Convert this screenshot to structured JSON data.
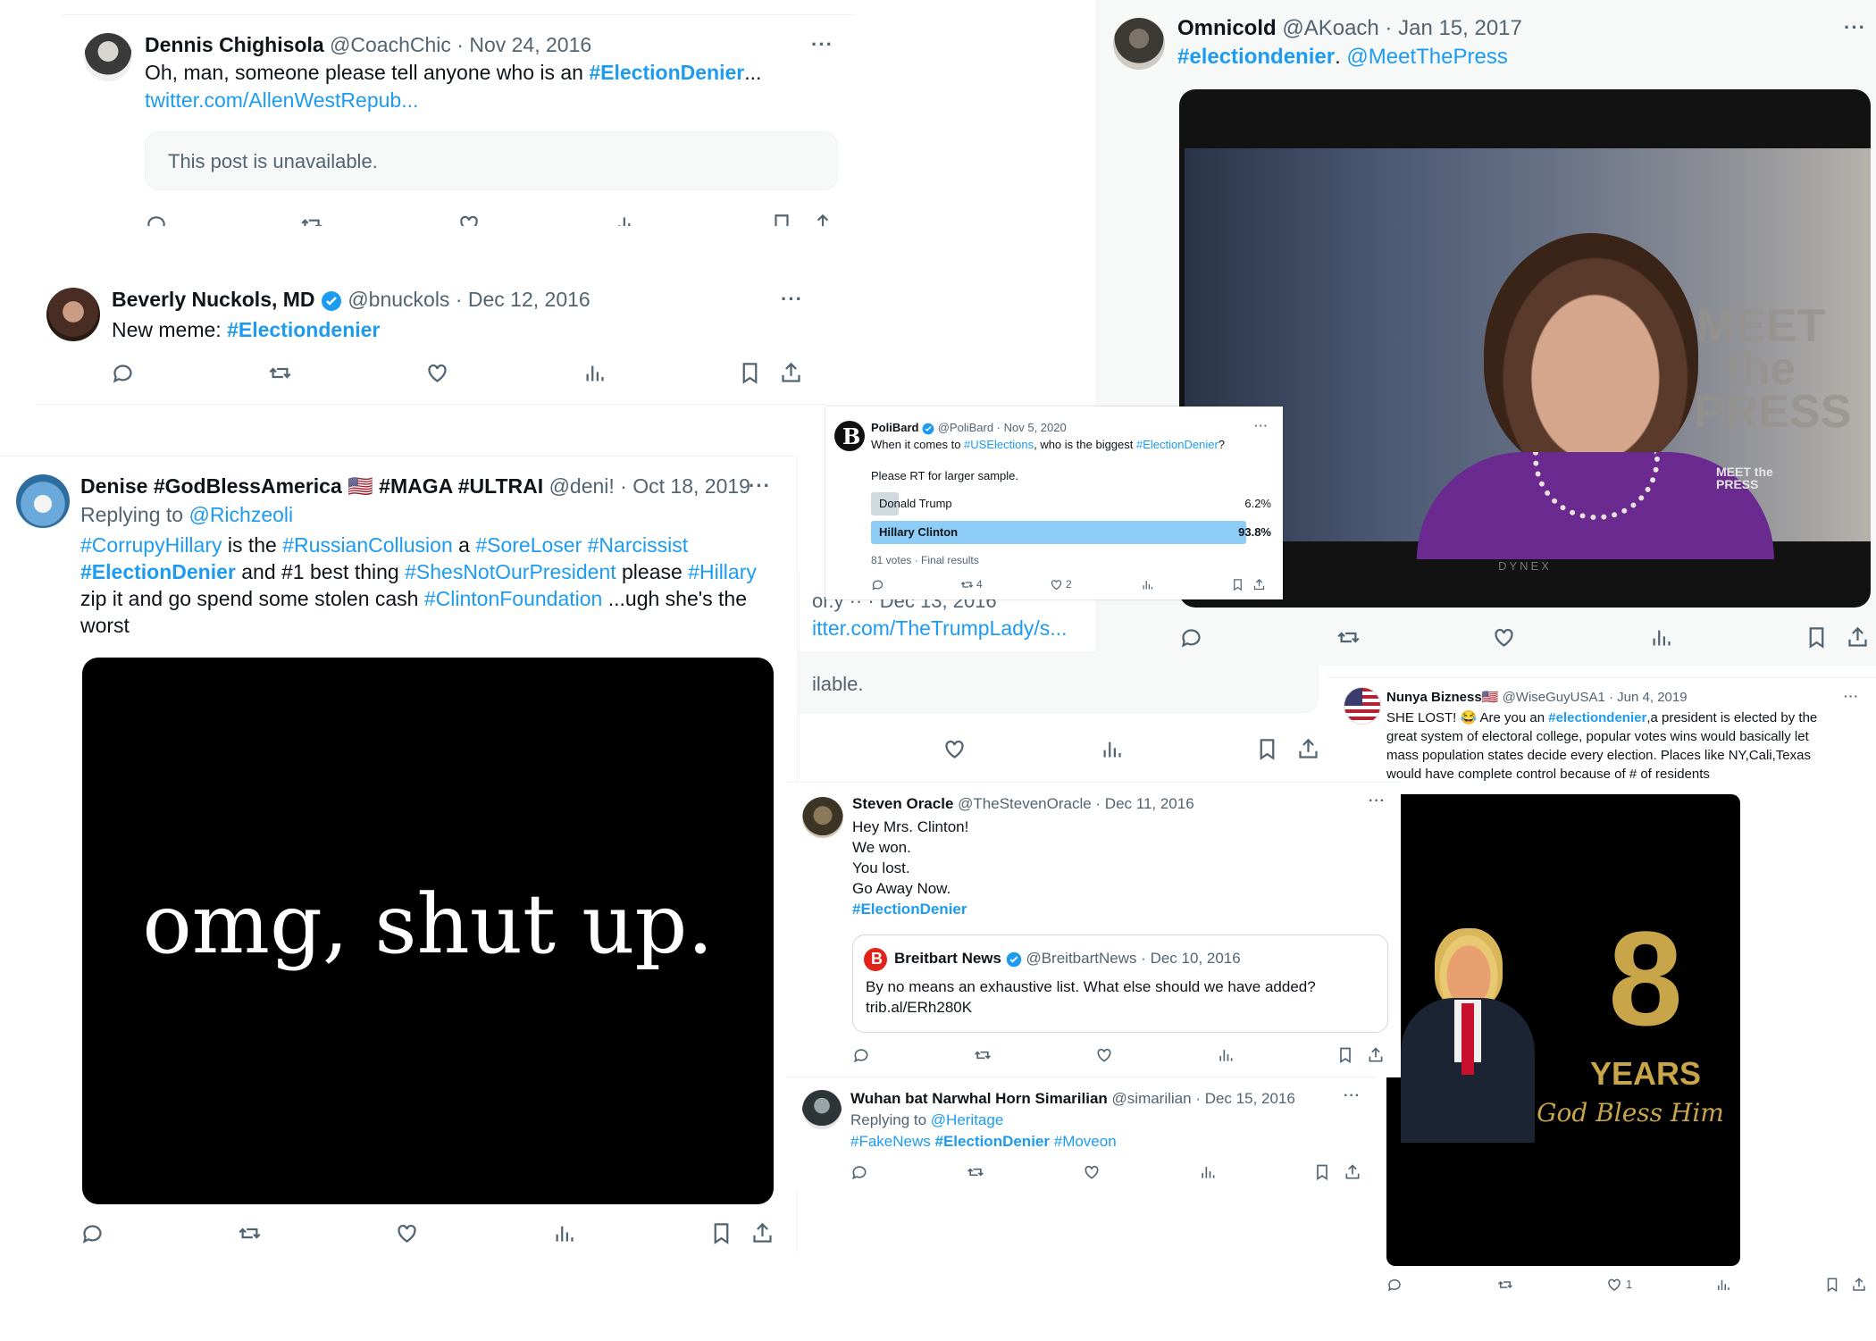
{
  "dennis": {
    "name": "Dennis Chighisola",
    "handle": "@CoachChic",
    "date": "Nov 24, 2016",
    "text": "Oh, man, someone please tell anyone who is an ",
    "tag": "#ElectionDenier",
    "ellipsis": "...",
    "link": "twitter.com/AllenWestRepub...",
    "unavailable": "This post is unavailable."
  },
  "beverly": {
    "name": "Beverly Nuckols, MD",
    "handle": "@bnuckols",
    "date": "Dec 12, 2016",
    "text": "New meme: ",
    "tag": "#Electiondenier"
  },
  "denise": {
    "name": "Denise #GodBlessAmerica 🇺🇸 #MAGA #ULTRAI",
    "handle": "@deni!",
    "date": "Oct 18, 2019",
    "replying_prefix": "Replying to ",
    "replying_to": "@Richzeoli",
    "line1": {
      "t1": "#CorrupyHillary",
      "t2": " is the ",
      "t3": "#RussianCollusion",
      "t4": " a ",
      "t5": "#SoreLoser",
      "t6": " ",
      "t7": "#Narcissist"
    },
    "line2": {
      "t1": "#ElectionDenier",
      "t2": " and #1 best thing ",
      "t3": "#ShesNotOurPresident",
      "t4": " please ",
      "t5": "#Hillary"
    },
    "line3": {
      "t1": "zip it and  go spend some stolen cash ",
      "t2": "#ClintonFoundation",
      "t3": " ...ugh she's the"
    },
    "line4": "worst",
    "image_text": "omg, shut up."
  },
  "omnicold": {
    "name": "Omnicold",
    "handle": "@AKoach",
    "date": "Jan 15, 2017",
    "tag": "#electiondenier",
    "sep": ". ",
    "mention": "@MeetThePress",
    "logo": "MEET the PRESS",
    "small_logo": "MEET the PRESS",
    "tv_brand": "DYNEX"
  },
  "poll": {
    "name": "PoliBard",
    "handle": "@PoliBard",
    "date": "Nov 5, 2020",
    "q1": "When it comes to ",
    "q2": "#USElections",
    "q3": ", who is the biggest ",
    "q4": "#ElectionDenier",
    "q5": "?",
    "note": "Please RT for larger sample.",
    "options": [
      {
        "label": "Donald Trump",
        "pct": "6.2%",
        "value": 6.2
      },
      {
        "label": "Hillary Clinton",
        "pct": "93.8%",
        "value": 93.8
      }
    ],
    "footer": "81 votes · Final results",
    "retweets": "4",
    "likes": "2"
  },
  "fragment": {
    "line1": "or.y ·· · Dec 13, 2016",
    "line2": "itter.com/TheTrumpLady/s...",
    "line3": "ilable."
  },
  "nunya": {
    "name": "Nunya Bizness🇺🇸",
    "handle": "@WiseGuyUSA1",
    "date": "Jun 4, 2019",
    "l1a": "SHE LOST! 😂 Are you an ",
    "l1b": "#electiondenier",
    "l1c": ",a president is elected by the",
    "l2": "great system of electoral college, popular votes wins would basically let",
    "l3": "mass population states decide every election. Places like NY,Cali,Texas",
    "l4": "would have complete control because of # of residents",
    "big": "8",
    "years": "YEARS",
    "script": "God Bless Him",
    "likes": "1"
  },
  "steven": {
    "name": "Steven Oracle",
    "handle": "@TheStevenOracle",
    "date": "Dec 11, 2016",
    "lines": [
      "Hey Mrs. Clinton!",
      "We won.",
      "You lost.",
      "Go Away Now."
    ],
    "tag": "#ElectionDenier",
    "quote": {
      "name": "Breitbart News",
      "handle": "@BreitbartNews",
      "date": "Dec 10, 2016",
      "text1": "By no means an exhaustive list. What else should we have added?",
      "text2": "trib.al/ERh280K"
    }
  },
  "wuhan": {
    "name": "Wuhan bat Narwhal Horn Simarilian",
    "handle": "@simarilian",
    "date": "Dec 15, 2016",
    "replying_prefix": "Replying to ",
    "replying_to": "@Heritage",
    "t1": "#FakeNews",
    "t2": "#ElectionDenier",
    "t3": "#Moveon"
  },
  "ui": {
    "dot": " · ",
    "more": "···"
  },
  "colors": {
    "link": "#1d9bf0",
    "text": "#0f1419",
    "muted": "#536471",
    "poll_bar": "#8ecdf8",
    "poll_bar_light": "#cfd9de"
  }
}
